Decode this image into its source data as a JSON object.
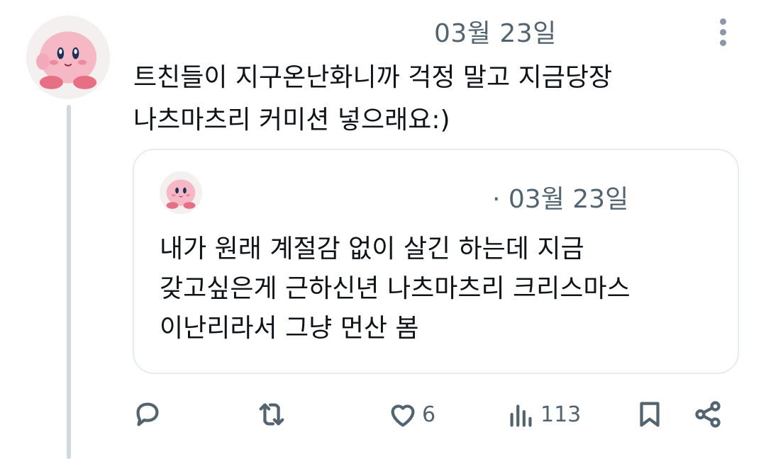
{
  "tweet": {
    "date": "03월 23일",
    "text_lines": [
      "트친들이 지구온난화니까 걱정 말고 지금당장",
      "나츠마츠리 커미션 넣으래요:)"
    ]
  },
  "quoted_tweet": {
    "date": "· 03월 23일",
    "text_lines": [
      "내가 원래 계절감 없이 살긴 하는데 지금",
      "갖고싶은게 근하신년 나츠마츠리 크리스마스",
      "이난리라서 그냥 먼산 봄"
    ]
  },
  "actions": {
    "reply_icon": "reply-icon",
    "retweet_icon": "retweet-icon",
    "like_icon": "heart-icon",
    "like_count": "6",
    "views_icon": "views-bar-chart-icon",
    "views_count": "113",
    "bookmark_icon": "bookmark-icon",
    "share_icon": "share-icon"
  },
  "colors": {
    "text": "#0f1419",
    "secondary": "#536471",
    "border": "#e6ecf0",
    "thread_line": "#cfd9de"
  }
}
